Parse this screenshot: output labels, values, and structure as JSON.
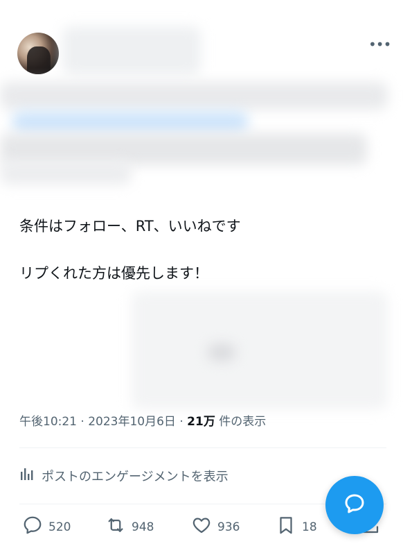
{
  "post": {
    "text_line1": "条件はフォロー、RT、いいねです",
    "text_line2": "リプくれた方は優先します！"
  },
  "meta": {
    "time": "午後10:21",
    "sep1": " · ",
    "date": "2023年10月6日",
    "sep2": " · ",
    "views": "21万",
    "views_suffix": " 件の表示"
  },
  "engagement_link": "ポストのエンゲージメントを表示",
  "actions": {
    "replies": "520",
    "reposts": "948",
    "likes": "936",
    "bookmarks": "18"
  },
  "colors": {
    "accent": "#1d9bf0",
    "secondary_text": "#536471"
  }
}
